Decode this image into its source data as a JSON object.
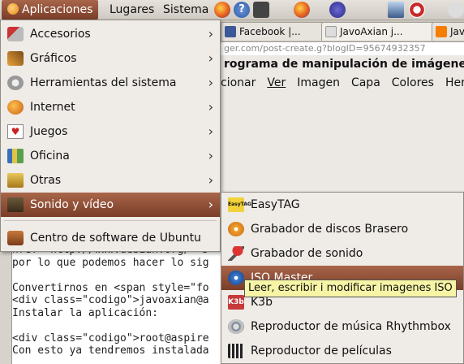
{
  "panel": {
    "menus": [
      "Aplicaciones",
      "Lugares",
      "Sistema"
    ]
  },
  "browser": {
    "tabs": [
      "Facebook |...",
      "JavoAxian j...",
      "Jav"
    ],
    "url_fragment": "ger.com/post-create.g?blogID=95674932357",
    "page_title": "rograma de manipulación de imágenes de",
    "menubar": [
      "cionar",
      "Ver",
      "Imagen",
      "Capa",
      "Colores",
      "Herra"
    ]
  },
  "editor": {
    "lines": [
      "href= http://www.debian.org/ >D",
      "por lo que podemos hacer lo sig",
      "",
      "Convertirnos en <span style=\"fo",
      "<div class=\"codigo\">javoaxian@a",
      "Instalar la aplicación:",
      "",
      "<div class=\"codigo\">root@aspire",
      "Con esto ya tendremos instalada"
    ]
  },
  "appmenu": {
    "items": [
      {
        "label": "Accesorios",
        "icon": "accessories-icon"
      },
      {
        "label": "Gráficos",
        "icon": "graphics-icon"
      },
      {
        "label": "Herramientas del sistema",
        "icon": "system-tools-icon"
      },
      {
        "label": "Internet",
        "icon": "internet-icon"
      },
      {
        "label": "Juegos",
        "icon": "games-icon"
      },
      {
        "label": "Oficina",
        "icon": "office-icon"
      },
      {
        "label": "Otras",
        "icon": "other-icon"
      },
      {
        "label": "Sonido y vídeo",
        "icon": "sound-video-icon"
      }
    ],
    "footer": "Centro de software de Ubuntu"
  },
  "submenu": {
    "items": [
      {
        "label": "EasyTAG",
        "icon": "easytag-icon"
      },
      {
        "label": "Grabador de discos Brasero",
        "icon": "brasero-icon"
      },
      {
        "label": "Grabador de sonido",
        "icon": "microphone-icon"
      },
      {
        "label": "ISO Master",
        "icon": "iso-master-icon"
      },
      {
        "label": "K3b",
        "icon": "k3b-icon"
      },
      {
        "label": "Reproductor de música Rhythmbox",
        "icon": "rhythmbox-icon"
      },
      {
        "label": "Reproductor de películas",
        "icon": "movie-player-icon"
      }
    ]
  },
  "tooltip": "Leer, escribir i modificar imagenes ISO",
  "colors": {
    "selection": "#8a4a30",
    "menu_bg": "#efebe7",
    "tooltip_bg": "#f7f4a6"
  }
}
